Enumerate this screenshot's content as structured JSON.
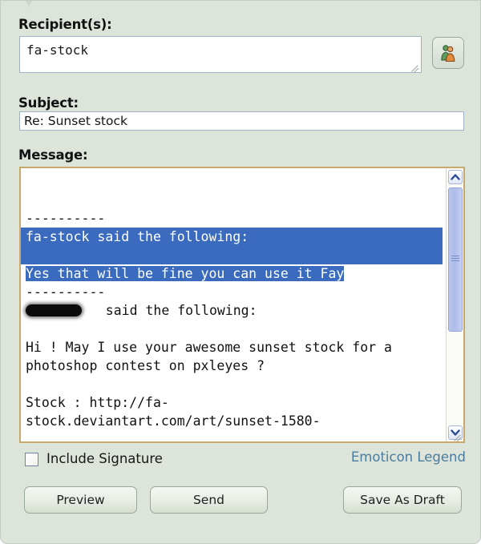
{
  "theme": {
    "panel_bg": "#dde5db",
    "input_bg": "#ffffff",
    "input_border": "#9fb3c4",
    "message_border": "#c9a96b",
    "selection_bg": "#3a6bbe",
    "selection_fg": "#ffffff",
    "link_color": "#4a7c9e",
    "button_border": "#9aa89a",
    "text_color": "#111111"
  },
  "form": {
    "recipients": {
      "label": "Recipient(s):",
      "value": "fa-stock",
      "placeholder": "",
      "addressbook_icon": "contacts-people-icon",
      "resize_grip_icon": "resize-grip-icon"
    },
    "subject": {
      "label": "Subject:",
      "value": "Re: Sunset stock",
      "placeholder": ""
    },
    "message": {
      "label": "Message:",
      "lines": [
        {
          "text": "",
          "selected": false
        },
        {
          "text": "",
          "selected": false
        },
        {
          "text": "----------",
          "selected": false
        },
        {
          "text": "fa-stock said the following:",
          "selected": true,
          "full_width": true
        },
        {
          "text": "",
          "selected": true,
          "full_width": true
        },
        {
          "text": "Yes that will be fine you can use it Fay",
          "selected": true,
          "full_width": false
        },
        {
          "text": "----------",
          "selected": false
        },
        {
          "text": "REDACTED said the following:",
          "selected": false,
          "redacted_prefix": true
        },
        {
          "text": "",
          "selected": false
        },
        {
          "text": "Hi ! May I use your awesome sunset stock for a",
          "selected": false
        },
        {
          "text": "photoshop contest on pxleyes ?",
          "selected": false
        },
        {
          "text": "",
          "selected": false
        },
        {
          "text": "Stock : http://fa-",
          "selected": false
        },
        {
          "text": "stock.deviantart.com/art/sunset-1580-",
          "selected": false
        }
      ],
      "scrollbar": {
        "up_icon": "chevron-up-icon",
        "down_icon": "chevron-down-icon",
        "thumb_grip_icon": "grip-lines-icon"
      },
      "resize_grip_icon": "resize-grip-icon"
    }
  },
  "options": {
    "include_signature": {
      "label": "Include Signature",
      "checked": false
    },
    "emoticon_legend_link": "Emoticon Legend"
  },
  "actions": {
    "preview": "Preview",
    "send": "Send",
    "save_as_draft": "Save As Draft"
  },
  "decor": {
    "top_chevron_icon": "chevron-down-icon"
  }
}
